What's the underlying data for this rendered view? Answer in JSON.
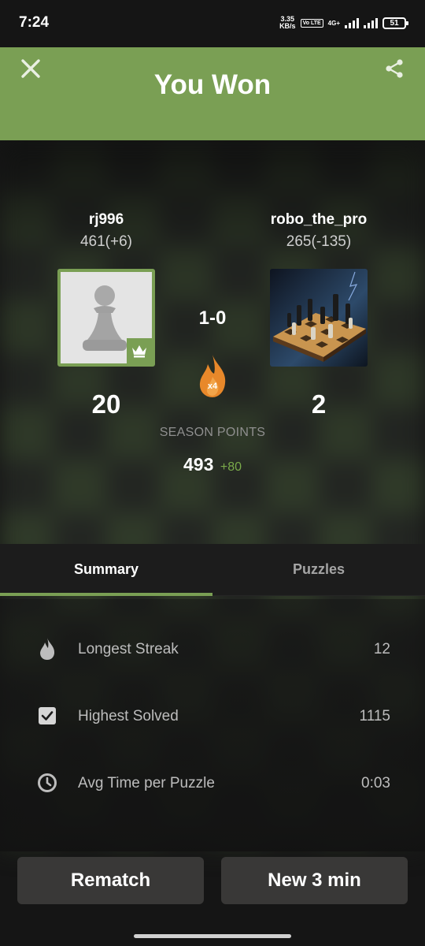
{
  "status_bar": {
    "time": "7:24",
    "net_speed_value": "3.35",
    "net_speed_unit": "KB/s",
    "volte": "Vo LTE",
    "net_type": "4G+",
    "battery": "51"
  },
  "header": {
    "title": "You Won",
    "close_icon": "close-icon",
    "share_icon": "share-icon",
    "background_color": "#7a9f54"
  },
  "players": {
    "left": {
      "name": "rj996",
      "rating": "461(+6)",
      "avatar": "pawn-avatar",
      "badge": "crown-icon",
      "score": "20"
    },
    "right": {
      "name": "robo_the_pro",
      "rating": "265(-135)",
      "avatar": "chessboard-photo-avatar",
      "score": "2"
    }
  },
  "match": {
    "result": "1-0",
    "streak_icon": "flame-icon",
    "streak_multiplier": "x4"
  },
  "season": {
    "label": "SEASON POINTS",
    "points": "493",
    "delta": "+80"
  },
  "tabs": [
    {
      "label": "Summary",
      "active": true
    },
    {
      "label": "Puzzles",
      "active": false
    }
  ],
  "stats": [
    {
      "icon": "flame-icon",
      "label": "Longest Streak",
      "value": "12"
    },
    {
      "icon": "checkbox-icon",
      "label": "Highest Solved",
      "value": "1115"
    },
    {
      "icon": "clock-icon",
      "label": "Avg Time per Puzzle",
      "value": "0:03"
    }
  ],
  "buttons": {
    "rematch": "Rematch",
    "new_game": "New 3 min"
  },
  "colors": {
    "accent_green": "#7a9f54",
    "positive_delta": "#7aaa4a",
    "flame_orange": "#e8882a",
    "button_bg": "#393837"
  }
}
